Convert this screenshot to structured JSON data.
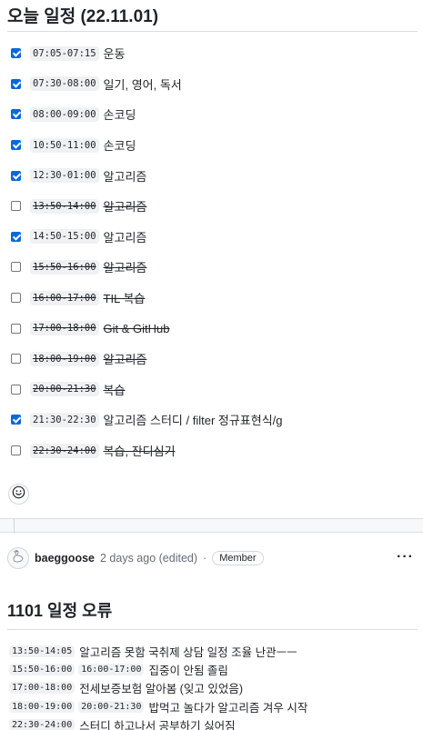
{
  "heading": {
    "title": "오늘 일정 (22.11.01)"
  },
  "tasks": [
    {
      "checked": true,
      "done": false,
      "time": "07:05-07:15",
      "label": "운동"
    },
    {
      "checked": true,
      "done": false,
      "time": "07:30-08:00",
      "label": "일기, 영어, 독서"
    },
    {
      "checked": true,
      "done": false,
      "time": "08:00-09:00",
      "label": "손코딩"
    },
    {
      "checked": true,
      "done": false,
      "time": "10:50-11:00",
      "label": "손코딩"
    },
    {
      "checked": true,
      "done": false,
      "time": "12:30-01:00",
      "label": "알고리즘"
    },
    {
      "checked": false,
      "done": true,
      "time": "13:50-14:00",
      "label": "알고리즘"
    },
    {
      "checked": true,
      "done": false,
      "time": "14:50-15:00",
      "label": "알고리즘"
    },
    {
      "checked": false,
      "done": true,
      "time": "15:50-16:00",
      "label": "알고리즘"
    },
    {
      "checked": false,
      "done": true,
      "time": "16:00-17:00",
      "label": "TIL 복습"
    },
    {
      "checked": false,
      "done": true,
      "time": "17:00-18:00",
      "label": "Git & GitHub"
    },
    {
      "checked": false,
      "done": true,
      "time": "18:00-19:00",
      "label": "알고리즘"
    },
    {
      "checked": false,
      "done": true,
      "time": "20:00-21:30",
      "label": "복습"
    },
    {
      "checked": true,
      "done": false,
      "time": "21:30-22:30",
      "label": "알고리즘 스터디 / filter 정규표현식/g"
    },
    {
      "checked": false,
      "done": true,
      "time": "22:30-24:00",
      "label": "복습, 잔디심기"
    }
  ],
  "comment": {
    "author": "baeggoose",
    "meta": "2 days ago (edited)",
    "separator": "·",
    "role_badge": "Member",
    "more_label": "···"
  },
  "section2": {
    "title": "1101 일정 오류"
  },
  "log": [
    {
      "codes": [
        "13:50-14:05"
      ],
      "text": "알고리즘 못함 국취제 상담 일정 조율 난관ㅡㅡ"
    },
    {
      "codes": [
        "15:50-16:00",
        "16:00-17:00"
      ],
      "text": "집중이 안됨 졸림"
    },
    {
      "codes": [
        "17:00-18:00"
      ],
      "text": "전세보증보험 알아봄 (잊고 있었음)"
    },
    {
      "codes": [
        "18:00-19:00",
        "20:00-21:30"
      ],
      "text": "밥먹고 놀다가 알고리즘 겨우 시작"
    },
    {
      "codes": [
        "22:30-24:00"
      ],
      "text": "스터디 하고나서 공부하기 싫어짐"
    }
  ],
  "icons": {
    "emoji_button": "smiley-icon",
    "avatar": "goose-avatar-icon"
  },
  "colors": {
    "checkbox_checked": "#0969da",
    "code_background": "#eff1f3",
    "muted_text": "#656d76",
    "border": "#d0d7de"
  }
}
